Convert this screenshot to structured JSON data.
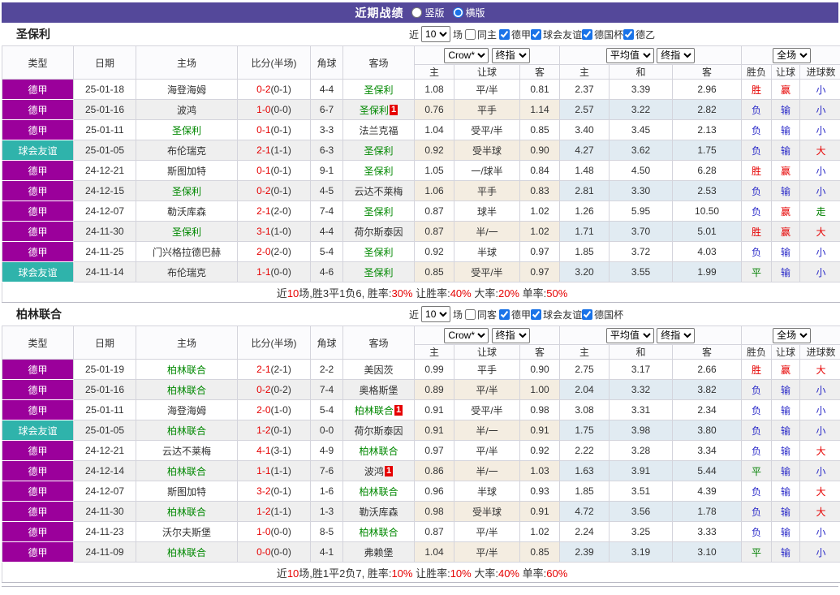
{
  "topbar": {
    "title": "近期战绩",
    "radios": [
      {
        "label": "竖版",
        "selected": false
      },
      {
        "label": "横版",
        "selected": true
      }
    ]
  },
  "table_header": {
    "static_cols": [
      "类型",
      "日期",
      "主场",
      "比分(半场)",
      "角球",
      "客场"
    ],
    "odds_selects": [
      "Crow*",
      "终指"
    ],
    "odds_cols": [
      "主",
      "让球",
      "客"
    ],
    "avg_selects": [
      "平均值",
      "终指"
    ],
    "avg_cols": [
      "主",
      "和",
      "客"
    ],
    "scope_select": "全场",
    "result_cols": [
      "胜负",
      "让球",
      "进球数"
    ]
  },
  "colors": {
    "topbar_bg": "#54489a",
    "league_badge": "#9b009b",
    "friendly_badge": "#2fb3ab",
    "focus_team": "#008800",
    "win_red": "#e60000",
    "lose_blue": "#2a2ac8",
    "draw_green": "#008000"
  },
  "sections": [
    {
      "team": "圣保利",
      "filter": {
        "near": "近",
        "count": "10",
        "games": "场",
        "same": {
          "label": "同主",
          "checked": false
        },
        "leagues": [
          {
            "label": "德甲",
            "checked": true
          },
          {
            "label": "球会友谊",
            "checked": true
          },
          {
            "label": "德国杯",
            "checked": true
          },
          {
            "label": "德乙",
            "checked": true
          }
        ]
      },
      "rows": [
        {
          "type": "德甲",
          "friendly": false,
          "date": "25-01-18",
          "home": "海登海姆",
          "home_focus": false,
          "home_badge": "",
          "score": "0-2",
          "half": "(0-1)",
          "corners": "4-4",
          "away": "圣保利",
          "away_focus": true,
          "away_badge": "",
          "odds": [
            "1.08",
            "平/半",
            "0.81"
          ],
          "avg": [
            "2.37",
            "3.39",
            "2.96"
          ],
          "results": [
            [
              "胜",
              "r"
            ],
            [
              "赢",
              "r"
            ],
            [
              "小",
              "b"
            ]
          ]
        },
        {
          "type": "德甲",
          "friendly": false,
          "date": "25-01-16",
          "home": "波鸿",
          "home_focus": false,
          "home_badge": "",
          "score": "1-0",
          "half": "(0-0)",
          "corners": "6-7",
          "away": "圣保利",
          "away_focus": true,
          "away_badge": "1",
          "odds": [
            "0.76",
            "平手",
            "1.14"
          ],
          "avg": [
            "2.57",
            "3.22",
            "2.82"
          ],
          "results": [
            [
              "负",
              "b"
            ],
            [
              "输",
              "b"
            ],
            [
              "小",
              "b"
            ]
          ]
        },
        {
          "type": "德甲",
          "friendly": false,
          "date": "25-01-11",
          "home": "圣保利",
          "home_focus": true,
          "home_badge": "",
          "score": "0-1",
          "half": "(0-1)",
          "corners": "3-3",
          "away": "法兰克福",
          "away_focus": false,
          "away_badge": "",
          "odds": [
            "1.04",
            "受平/半",
            "0.85"
          ],
          "avg": [
            "3.40",
            "3.45",
            "2.13"
          ],
          "results": [
            [
              "负",
              "b"
            ],
            [
              "输",
              "b"
            ],
            [
              "小",
              "b"
            ]
          ]
        },
        {
          "type": "球会友谊",
          "friendly": true,
          "date": "25-01-05",
          "home": "布伦瑞克",
          "home_focus": false,
          "home_badge": "",
          "score": "2-1",
          "half": "(1-1)",
          "corners": "6-3",
          "away": "圣保利",
          "away_focus": true,
          "away_badge": "",
          "odds": [
            "0.92",
            "受半球",
            "0.90"
          ],
          "avg": [
            "4.27",
            "3.62",
            "1.75"
          ],
          "results": [
            [
              "负",
              "b"
            ],
            [
              "输",
              "b"
            ],
            [
              "大",
              "r"
            ]
          ]
        },
        {
          "type": "德甲",
          "friendly": false,
          "date": "24-12-21",
          "home": "斯图加特",
          "home_focus": false,
          "home_badge": "",
          "score": "0-1",
          "half": "(0-1)",
          "corners": "9-1",
          "away": "圣保利",
          "away_focus": true,
          "away_badge": "",
          "odds": [
            "1.05",
            "一/球半",
            "0.84"
          ],
          "avg": [
            "1.48",
            "4.50",
            "6.28"
          ],
          "results": [
            [
              "胜",
              "r"
            ],
            [
              "赢",
              "r"
            ],
            [
              "小",
              "b"
            ]
          ]
        },
        {
          "type": "德甲",
          "friendly": false,
          "date": "24-12-15",
          "home": "圣保利",
          "home_focus": true,
          "home_badge": "",
          "score": "0-2",
          "half": "(0-1)",
          "corners": "4-5",
          "away": "云达不莱梅",
          "away_focus": false,
          "away_badge": "",
          "odds": [
            "1.06",
            "平手",
            "0.83"
          ],
          "avg": [
            "2.81",
            "3.30",
            "2.53"
          ],
          "results": [
            [
              "负",
              "b"
            ],
            [
              "输",
              "b"
            ],
            [
              "小",
              "b"
            ]
          ]
        },
        {
          "type": "德甲",
          "friendly": false,
          "date": "24-12-07",
          "home": "勒沃库森",
          "home_focus": false,
          "home_badge": "",
          "score": "2-1",
          "half": "(2-0)",
          "corners": "7-4",
          "away": "圣保利",
          "away_focus": true,
          "away_badge": "",
          "odds": [
            "0.87",
            "球半",
            "1.02"
          ],
          "avg": [
            "1.26",
            "5.95",
            "10.50"
          ],
          "results": [
            [
              "负",
              "b"
            ],
            [
              "赢",
              "r"
            ],
            [
              "走",
              "g"
            ]
          ]
        },
        {
          "type": "德甲",
          "friendly": false,
          "date": "24-11-30",
          "home": "圣保利",
          "home_focus": true,
          "home_badge": "",
          "score": "3-1",
          "half": "(1-0)",
          "corners": "4-4",
          "away": "荷尔斯泰因",
          "away_focus": false,
          "away_badge": "",
          "odds": [
            "0.87",
            "半/一",
            "1.02"
          ],
          "avg": [
            "1.71",
            "3.70",
            "5.01"
          ],
          "results": [
            [
              "胜",
              "r"
            ],
            [
              "赢",
              "r"
            ],
            [
              "大",
              "r"
            ]
          ]
        },
        {
          "type": "德甲",
          "friendly": false,
          "date": "24-11-25",
          "home": "门兴格拉德巴赫",
          "home_focus": false,
          "home_badge": "",
          "score": "2-0",
          "half": "(2-0)",
          "corners": "5-4",
          "away": "圣保利",
          "away_focus": true,
          "away_badge": "",
          "odds": [
            "0.92",
            "半球",
            "0.97"
          ],
          "avg": [
            "1.85",
            "3.72",
            "4.03"
          ],
          "results": [
            [
              "负",
              "b"
            ],
            [
              "输",
              "b"
            ],
            [
              "小",
              "b"
            ]
          ]
        },
        {
          "type": "球会友谊",
          "friendly": true,
          "date": "24-11-14",
          "home": "布伦瑞克",
          "home_focus": false,
          "home_badge": "",
          "score": "1-1",
          "half": "(0-0)",
          "corners": "4-6",
          "away": "圣保利",
          "away_focus": true,
          "away_badge": "",
          "odds": [
            "0.85",
            "受平/半",
            "0.97"
          ],
          "avg": [
            "3.20",
            "3.55",
            "1.99"
          ],
          "results": [
            [
              "平",
              "g"
            ],
            [
              "输",
              "b"
            ],
            [
              "小",
              "b"
            ]
          ]
        }
      ],
      "summary": [
        {
          "t": "近",
          "c": "k"
        },
        {
          "t": "10",
          "c": "r"
        },
        {
          "t": "场,胜3平1负6, 胜率:",
          "c": "k"
        },
        {
          "t": "30%",
          "c": "r"
        },
        {
          "t": " 让胜率:",
          "c": "k"
        },
        {
          "t": "40%",
          "c": "r"
        },
        {
          "t": " 大率:",
          "c": "k"
        },
        {
          "t": "20%",
          "c": "r"
        },
        {
          "t": " 单率:",
          "c": "k"
        },
        {
          "t": "50%",
          "c": "r"
        }
      ]
    },
    {
      "team": "柏林联合",
      "filter": {
        "near": "近",
        "count": "10",
        "games": "场",
        "same": {
          "label": "同客",
          "checked": false
        },
        "leagues": [
          {
            "label": "德甲",
            "checked": true
          },
          {
            "label": "球会友谊",
            "checked": true
          },
          {
            "label": "德国杯",
            "checked": true
          }
        ]
      },
      "rows": [
        {
          "type": "德甲",
          "friendly": false,
          "date": "25-01-19",
          "home": "柏林联合",
          "home_focus": true,
          "home_badge": "",
          "score": "2-1",
          "half": "(2-1)",
          "corners": "2-2",
          "away": "美因茨",
          "away_focus": false,
          "away_badge": "",
          "odds": [
            "0.99",
            "平手",
            "0.90"
          ],
          "avg": [
            "2.75",
            "3.17",
            "2.66"
          ],
          "results": [
            [
              "胜",
              "r"
            ],
            [
              "赢",
              "r"
            ],
            [
              "大",
              "r"
            ]
          ]
        },
        {
          "type": "德甲",
          "friendly": false,
          "date": "25-01-16",
          "home": "柏林联合",
          "home_focus": true,
          "home_badge": "",
          "score": "0-2",
          "half": "(0-2)",
          "corners": "7-4",
          "away": "奥格斯堡",
          "away_focus": false,
          "away_badge": "",
          "odds": [
            "0.89",
            "平/半",
            "1.00"
          ],
          "avg": [
            "2.04",
            "3.32",
            "3.82"
          ],
          "results": [
            [
              "负",
              "b"
            ],
            [
              "输",
              "b"
            ],
            [
              "小",
              "b"
            ]
          ]
        },
        {
          "type": "德甲",
          "friendly": false,
          "date": "25-01-11",
          "home": "海登海姆",
          "home_focus": false,
          "home_badge": "",
          "score": "2-0",
          "half": "(1-0)",
          "corners": "5-4",
          "away": "柏林联合",
          "away_focus": true,
          "away_badge": "1",
          "odds": [
            "0.91",
            "受平/半",
            "0.98"
          ],
          "avg": [
            "3.08",
            "3.31",
            "2.34"
          ],
          "results": [
            [
              "负",
              "b"
            ],
            [
              "输",
              "b"
            ],
            [
              "小",
              "b"
            ]
          ]
        },
        {
          "type": "球会友谊",
          "friendly": true,
          "date": "25-01-05",
          "home": "柏林联合",
          "home_focus": true,
          "home_badge": "",
          "score": "1-2",
          "half": "(0-1)",
          "corners": "0-0",
          "away": "荷尔斯泰因",
          "away_focus": false,
          "away_badge": "",
          "odds": [
            "0.91",
            "半/一",
            "0.91"
          ],
          "avg": [
            "1.75",
            "3.98",
            "3.80"
          ],
          "results": [
            [
              "负",
              "b"
            ],
            [
              "输",
              "b"
            ],
            [
              "小",
              "b"
            ]
          ]
        },
        {
          "type": "德甲",
          "friendly": false,
          "date": "24-12-21",
          "home": "云达不莱梅",
          "home_focus": false,
          "home_badge": "",
          "score": "4-1",
          "half": "(3-1)",
          "corners": "4-9",
          "away": "柏林联合",
          "away_focus": true,
          "away_badge": "",
          "odds": [
            "0.97",
            "平/半",
            "0.92"
          ],
          "avg": [
            "2.22",
            "3.28",
            "3.34"
          ],
          "results": [
            [
              "负",
              "b"
            ],
            [
              "输",
              "b"
            ],
            [
              "大",
              "r"
            ]
          ]
        },
        {
          "type": "德甲",
          "friendly": false,
          "date": "24-12-14",
          "home": "柏林联合",
          "home_focus": true,
          "home_badge": "",
          "score": "1-1",
          "half": "(1-1)",
          "corners": "7-6",
          "away": "波鸿",
          "away_focus": false,
          "away_badge": "1",
          "odds": [
            "0.86",
            "半/一",
            "1.03"
          ],
          "avg": [
            "1.63",
            "3.91",
            "5.44"
          ],
          "results": [
            [
              "平",
              "g"
            ],
            [
              "输",
              "b"
            ],
            [
              "小",
              "b"
            ]
          ]
        },
        {
          "type": "德甲",
          "friendly": false,
          "date": "24-12-07",
          "home": "斯图加特",
          "home_focus": false,
          "home_badge": "",
          "score": "3-2",
          "half": "(0-1)",
          "corners": "1-6",
          "away": "柏林联合",
          "away_focus": true,
          "away_badge": "",
          "odds": [
            "0.96",
            "半球",
            "0.93"
          ],
          "avg": [
            "1.85",
            "3.51",
            "4.39"
          ],
          "results": [
            [
              "负",
              "b"
            ],
            [
              "输",
              "b"
            ],
            [
              "大",
              "r"
            ]
          ]
        },
        {
          "type": "德甲",
          "friendly": false,
          "date": "24-11-30",
          "home": "柏林联合",
          "home_focus": true,
          "home_badge": "",
          "score": "1-2",
          "half": "(1-1)",
          "corners": "1-3",
          "away": "勒沃库森",
          "away_focus": false,
          "away_badge": "",
          "odds": [
            "0.98",
            "受半球",
            "0.91"
          ],
          "avg": [
            "4.72",
            "3.56",
            "1.78"
          ],
          "results": [
            [
              "负",
              "b"
            ],
            [
              "输",
              "b"
            ],
            [
              "大",
              "r"
            ]
          ]
        },
        {
          "type": "德甲",
          "friendly": false,
          "date": "24-11-23",
          "home": "沃尔夫斯堡",
          "home_focus": false,
          "home_badge": "",
          "score": "1-0",
          "half": "(0-0)",
          "corners": "8-5",
          "away": "柏林联合",
          "away_focus": true,
          "away_badge": "",
          "odds": [
            "0.87",
            "平/半",
            "1.02"
          ],
          "avg": [
            "2.24",
            "3.25",
            "3.33"
          ],
          "results": [
            [
              "负",
              "b"
            ],
            [
              "输",
              "b"
            ],
            [
              "小",
              "b"
            ]
          ]
        },
        {
          "type": "德甲",
          "friendly": false,
          "date": "24-11-09",
          "home": "柏林联合",
          "home_focus": true,
          "home_badge": "",
          "score": "0-0",
          "half": "(0-0)",
          "corners": "4-1",
          "away": "弗赖堡",
          "away_focus": false,
          "away_badge": "",
          "odds": [
            "1.04",
            "平/半",
            "0.85"
          ],
          "avg": [
            "2.39",
            "3.19",
            "3.10"
          ],
          "results": [
            [
              "平",
              "g"
            ],
            [
              "输",
              "b"
            ],
            [
              "小",
              "b"
            ]
          ]
        }
      ],
      "summary": [
        {
          "t": "近",
          "c": "k"
        },
        {
          "t": "10",
          "c": "r"
        },
        {
          "t": "场,胜1平2负7, 胜率:",
          "c": "k"
        },
        {
          "t": "10%",
          "c": "r"
        },
        {
          "t": " 让胜率:",
          "c": "k"
        },
        {
          "t": "10%",
          "c": "r"
        },
        {
          "t": " 大率:",
          "c": "k"
        },
        {
          "t": "40%",
          "c": "r"
        },
        {
          "t": " 单率:",
          "c": "k"
        },
        {
          "t": "60%",
          "c": "r"
        }
      ]
    }
  ]
}
